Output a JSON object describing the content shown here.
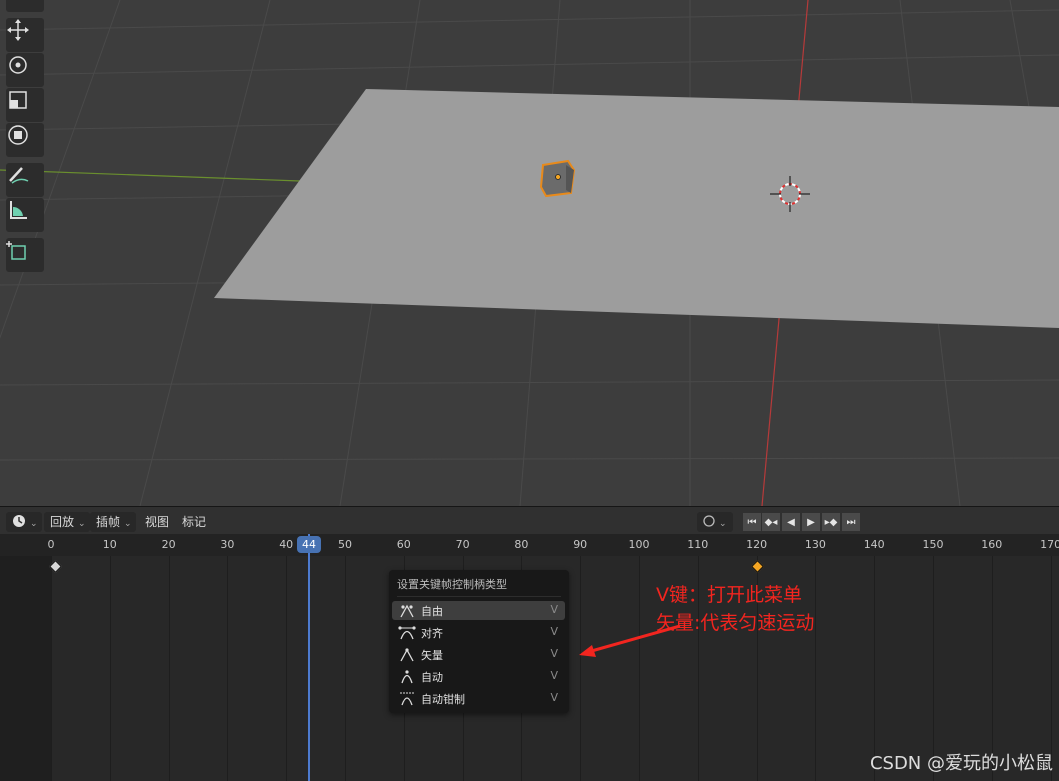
{
  "timeline": {
    "editor_type": "dopesheet-timeline",
    "menus": {
      "playback": "回放",
      "keying": "插帧",
      "view": "视图",
      "marker": "标记"
    },
    "ruler_ticks": [
      "0",
      "10",
      "20",
      "30",
      "40",
      "50",
      "60",
      "70",
      "80",
      "90",
      "100",
      "110",
      "120",
      "130",
      "140",
      "150",
      "160",
      "170"
    ],
    "current_frame": "44",
    "playback_icons": [
      "jump-start-icon",
      "prev-keyframe-icon",
      "play-reverse-icon",
      "play-icon",
      "next-keyframe-icon",
      "jump-end-icon"
    ]
  },
  "menu": {
    "title": "设置关键帧控制柄类型",
    "items": [
      {
        "label": "自由",
        "key": "V"
      },
      {
        "label": "对齐",
        "key": "V"
      },
      {
        "label": "矢量",
        "key": "V"
      },
      {
        "label": "自动",
        "key": "V"
      },
      {
        "label": "自动钳制",
        "key": "V"
      }
    ]
  },
  "annotation": {
    "line1": "V键：打开此菜单",
    "line2": "矢量:代表匀速运动",
    "color": "#f2251f"
  },
  "watermark": "CSDN @爱玩的小松鼠",
  "colors": {
    "selection": "#e88a1b",
    "playhead": "#4772b3",
    "keyframe_selected": "#f5a623"
  }
}
